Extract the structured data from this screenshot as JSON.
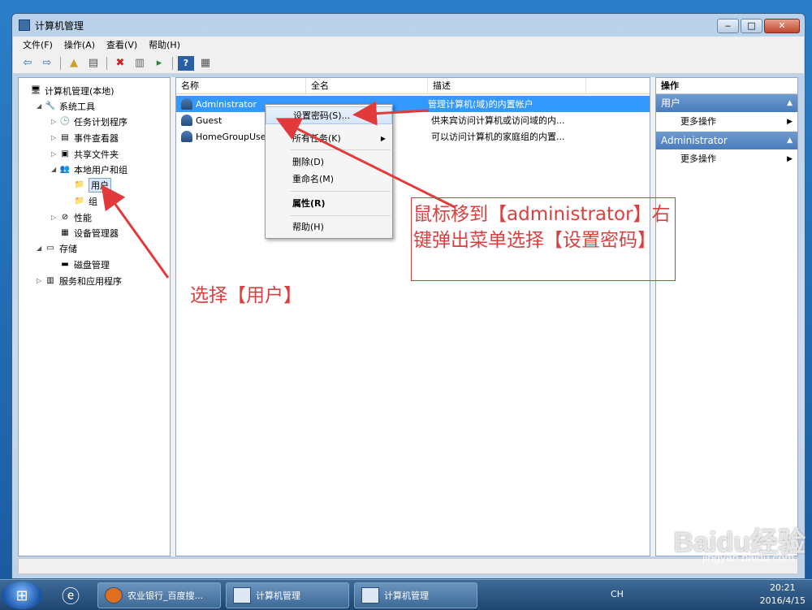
{
  "window": {
    "title": "计算机管理",
    "min": "‒",
    "max": "□",
    "close": "✕"
  },
  "menu": [
    "文件(F)",
    "操作(A)",
    "查看(V)",
    "帮助(H)"
  ],
  "tree": [
    {
      "label": "计算机管理(本地)",
      "icon": "🖥",
      "tw": "",
      "indent": 0
    },
    {
      "label": "系统工具",
      "icon": "🔧",
      "tw": "◢",
      "indent": 1
    },
    {
      "label": "任务计划程序",
      "icon": "🕒",
      "tw": "▷",
      "indent": 2
    },
    {
      "label": "事件查看器",
      "icon": "▤",
      "tw": "▷",
      "indent": 2
    },
    {
      "label": "共享文件夹",
      "icon": "▣",
      "tw": "▷",
      "indent": 2
    },
    {
      "label": "本地用户和组",
      "icon": "👥",
      "tw": "◢",
      "indent": 2
    },
    {
      "label": "用户",
      "icon": "📁",
      "tw": "",
      "indent": 3
    },
    {
      "label": "组",
      "icon": "📁",
      "tw": "",
      "indent": 3
    },
    {
      "label": "性能",
      "icon": "⊘",
      "tw": "▷",
      "indent": 2
    },
    {
      "label": "设备管理器",
      "icon": "▦",
      "tw": "",
      "indent": 2
    },
    {
      "label": "存储",
      "icon": "▭",
      "tw": "◢",
      "indent": 1
    },
    {
      "label": "磁盘管理",
      "icon": "▬",
      "tw": "",
      "indent": 2
    },
    {
      "label": "服务和应用程序",
      "icon": "▥",
      "tw": "▷",
      "indent": 1
    }
  ],
  "list": {
    "headers": [
      "名称",
      "全名",
      "描述"
    ],
    "rows": [
      {
        "name": "Administrator",
        "full": "",
        "desc": "管理计算机(域)的内置帐户"
      },
      {
        "name": "Guest",
        "full": "",
        "desc": "供来宾访问计算机或访问域的内..."
      },
      {
        "name": "HomeGroupUse",
        "full": "",
        "desc": "可以访问计算机的家庭组的内置..."
      }
    ]
  },
  "actions": {
    "header": "操作",
    "sections": [
      {
        "title": "用户",
        "item": "更多操作"
      },
      {
        "title": "Administrator",
        "item": "更多操作"
      }
    ]
  },
  "context_menu": {
    "set_password": "设置密码(S)...",
    "all_tasks": "所有任务(K)",
    "delete": "删除(D)",
    "rename": "重命名(M)",
    "properties": "属性(R)",
    "help": "帮助(H)"
  },
  "annotations": {
    "box_text": "鼠标移到【administrator】右键弹出菜单选择【设置密码】",
    "user_note": "选择【用户】"
  },
  "taskbar": {
    "tasks": [
      "农业银行_百度搜...",
      "计算机管理",
      "计算机管理"
    ],
    "lang": "CH",
    "time": "20:21",
    "date": "2016/4/15"
  },
  "watermark": {
    "logo": "Baidu经验",
    "url": "jingyan.baidu.com"
  },
  "colors": {
    "annotation_red": "#d94040",
    "selection_blue": "#3399ff",
    "taskbar": "#2b5a8a"
  }
}
